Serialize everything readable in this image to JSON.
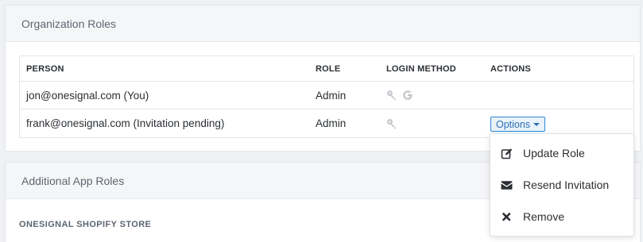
{
  "org_roles": {
    "title": "Organization Roles",
    "columns": [
      "PERSON",
      "ROLE",
      "LOGIN METHOD",
      "ACTIONS"
    ],
    "rows": [
      {
        "person": "jon@onesignal.com (You)",
        "role": "Admin",
        "login_icons": [
          "key-icon",
          "google-icon"
        ]
      },
      {
        "person": "frank@onesignal.com (Invitation pending)",
        "role": "Admin",
        "login_icons": [
          "key-icon"
        ],
        "action_label": "Options"
      }
    ]
  },
  "dropdown": {
    "items": [
      {
        "label": "Update Role",
        "icon": "edit-icon"
      },
      {
        "label": "Resend Invitation",
        "icon": "envelope-icon"
      },
      {
        "label": "Remove",
        "icon": "x-icon"
      }
    ]
  },
  "app_roles": {
    "title": "Additional App Roles",
    "section_label": "ONESIGNAL SHOPIFY STORE"
  }
}
